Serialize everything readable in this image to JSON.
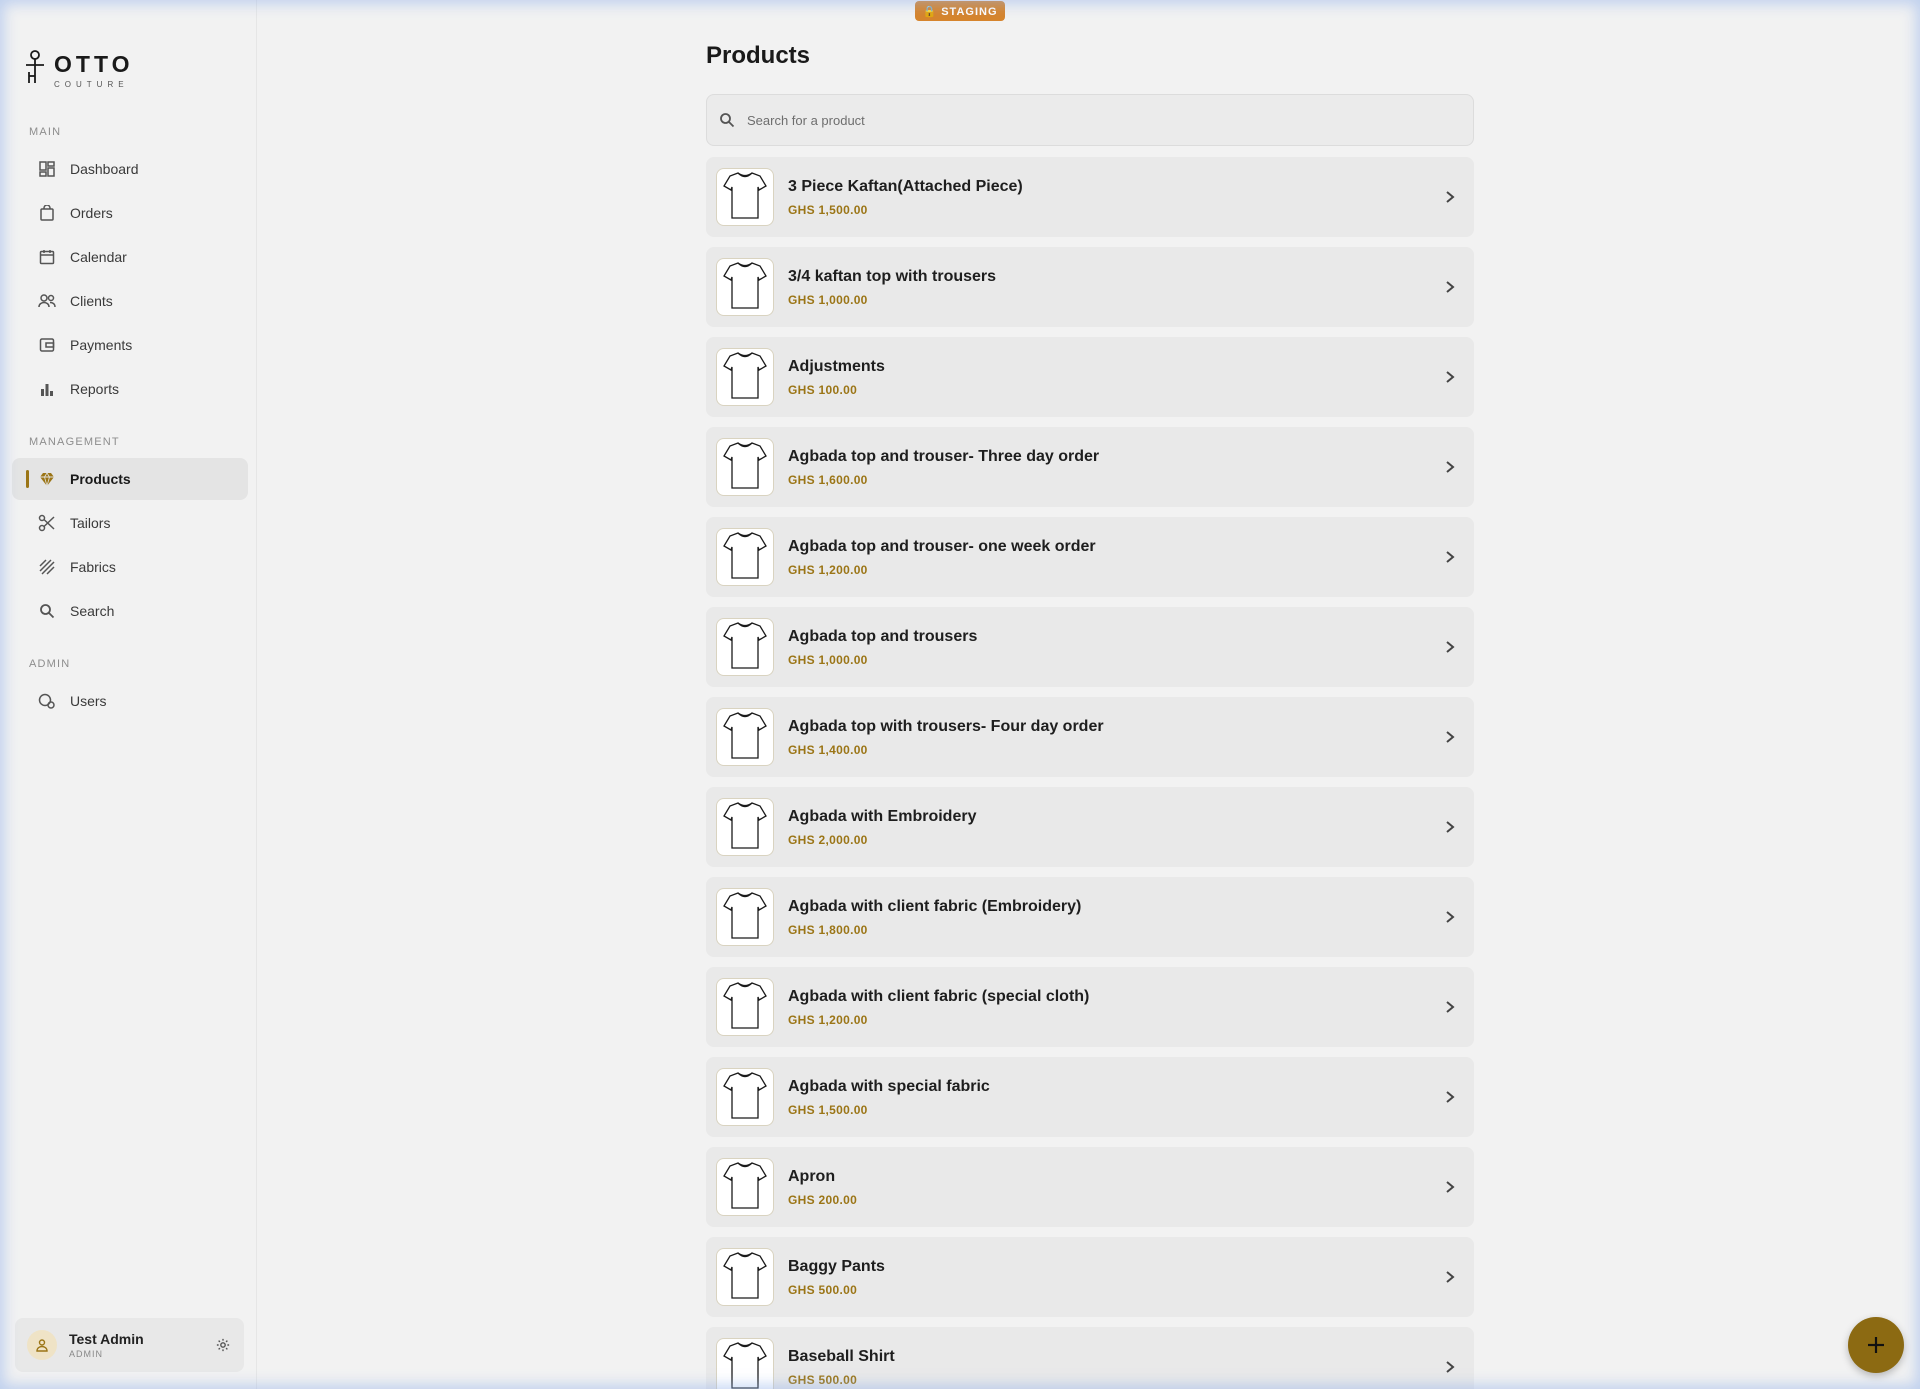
{
  "env_badge": "🔒 STAGING",
  "brand": {
    "name": "OTTO",
    "tagline": "COUTURE"
  },
  "sidebar": {
    "sections": [
      {
        "label": "MAIN",
        "items": [
          {
            "label": "Dashboard",
            "icon": "dashboard-icon"
          },
          {
            "label": "Orders",
            "icon": "shopping-bag-icon"
          },
          {
            "label": "Calendar",
            "icon": "calendar-icon"
          },
          {
            "label": "Clients",
            "icon": "people-icon"
          },
          {
            "label": "Payments",
            "icon": "wallet-icon"
          },
          {
            "label": "Reports",
            "icon": "bar-chart-icon"
          }
        ]
      },
      {
        "label": "MANAGEMENT",
        "items": [
          {
            "label": "Products",
            "icon": "diamond-icon",
            "active": true
          },
          {
            "label": "Tailors",
            "icon": "scissors-icon"
          },
          {
            "label": "Fabrics",
            "icon": "texture-icon"
          },
          {
            "label": "Search",
            "icon": "search-icon"
          }
        ]
      },
      {
        "label": "ADMIN",
        "items": [
          {
            "label": "Users",
            "icon": "user-settings-icon"
          }
        ]
      }
    ],
    "user": {
      "name": "Test Admin",
      "role": "ADMIN"
    }
  },
  "main": {
    "title": "Products",
    "search": {
      "placeholder": "Search for a product",
      "value": ""
    },
    "products": [
      {
        "name": "3 Piece Kaftan(Attached Piece)",
        "price": "GHS 1,500.00"
      },
      {
        "name": "3/4 kaftan top with trousers",
        "price": "GHS 1,000.00"
      },
      {
        "name": "Adjustments",
        "price": "GHS 100.00"
      },
      {
        "name": "Agbada top and trouser- Three day order",
        "price": "GHS 1,600.00"
      },
      {
        "name": "Agbada top and trouser- one week order",
        "price": "GHS 1,200.00"
      },
      {
        "name": "Agbada top and trousers",
        "price": "GHS 1,000.00"
      },
      {
        "name": "Agbada top with trousers- Four day order",
        "price": "GHS 1,400.00"
      },
      {
        "name": "Agbada with Embroidery",
        "price": "GHS 2,000.00"
      },
      {
        "name": "Agbada with client fabric (Embroidery)",
        "price": "GHS 1,800.00"
      },
      {
        "name": "Agbada with client fabric (special cloth)",
        "price": "GHS 1,200.00"
      },
      {
        "name": "Agbada with special fabric",
        "price": "GHS 1,500.00"
      },
      {
        "name": "Apron",
        "price": "GHS 200.00"
      },
      {
        "name": "Baggy Pants",
        "price": "GHS 500.00"
      },
      {
        "name": "Baseball Shirt",
        "price": "GHS 500.00"
      }
    ]
  },
  "colors": {
    "accent": "#9b7516",
    "fab": "#8c6a12",
    "badge": "#d6842c"
  }
}
